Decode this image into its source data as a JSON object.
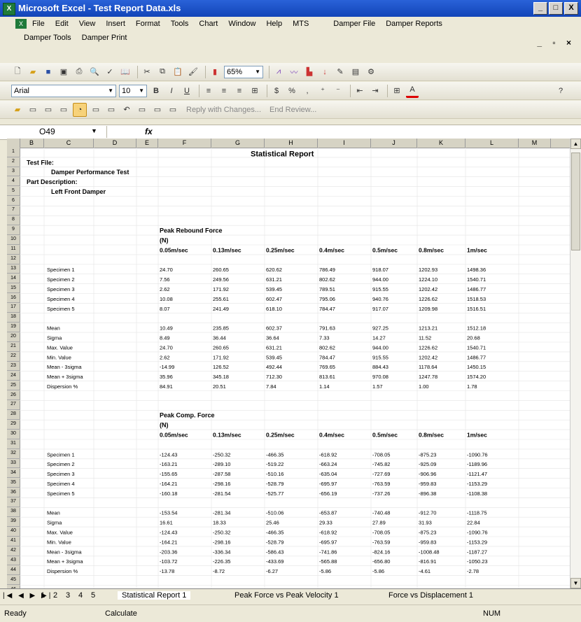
{
  "window": {
    "title": "Microsoft Excel - Test Report Data.xls",
    "minimize": "_",
    "maximize": "□",
    "close": "X"
  },
  "menu": {
    "row1": [
      "File",
      "Edit",
      "View",
      "Insert",
      "Format",
      "Tools",
      "Chart",
      "Window",
      "Help",
      "MTS",
      "Damper File",
      "Damper Reports"
    ],
    "row2": [
      "Damper Tools",
      "Damper Print"
    ],
    "doc_controls": "_ ▫ ×"
  },
  "toolbar": {
    "zoom": "65%",
    "font": "Arial",
    "size": "10",
    "reply": "Reply with Changes...",
    "end_review": "End Review..."
  },
  "formula": {
    "name_box": "O49",
    "fx": "fx"
  },
  "grid": {
    "columns": [
      "B",
      "C",
      "D",
      "E",
      "F",
      "G",
      "H",
      "I",
      "J",
      "K",
      "L",
      "M"
    ],
    "rows": [
      "1",
      "2",
      "3",
      "4",
      "5",
      "6",
      "7",
      "8",
      "9",
      "10",
      "11",
      "12",
      "13",
      "14",
      "15",
      "16",
      "17",
      "18",
      "19",
      "20",
      "21",
      "22",
      "23",
      "24",
      "25",
      "26",
      "27",
      "28",
      "29",
      "30",
      "31",
      "32",
      "33",
      "34",
      "35",
      "36",
      "37",
      "38",
      "39",
      "40",
      "41",
      "42",
      "43",
      "44",
      "45",
      "46"
    ]
  },
  "report": {
    "title": "Statistical Report",
    "test_file_label": "Test File:",
    "test_file": "Damper Performance Test",
    "part_label": "Part Description:",
    "part": "Left Front Damper",
    "speeds": [
      "0.05m/sec",
      "0.13m/sec",
      "0.25m/sec",
      "0.4m/sec",
      "0.5m/sec",
      "0.8m/sec",
      "1m/sec"
    ],
    "blocks": [
      {
        "title": "Peak Rebound Force",
        "unit": "(N)",
        "specimens": [
          {
            "label": "Specimen 1",
            "values": [
              "24.70",
              "260.65",
              "620.62",
              "786.49",
              "918.07",
              "1202.93",
              "1498.36"
            ]
          },
          {
            "label": "Specimen 2",
            "values": [
              "7.56",
              "249.56",
              "631.21",
              "802.62",
              "944.00",
              "1224.10",
              "1540.71"
            ]
          },
          {
            "label": "Specimen 3",
            "values": [
              "2.62",
              "171.92",
              "539.45",
              "789.51",
              "915.55",
              "1202.42",
              "1486.77"
            ]
          },
          {
            "label": "Specimen 4",
            "values": [
              "10.08",
              "255.61",
              "602.47",
              "795.06",
              "940.76",
              "1226.62",
              "1518.53"
            ]
          },
          {
            "label": "Specimen 5",
            "values": [
              "8.07",
              "241.49",
              "618.10",
              "784.47",
              "917.07",
              "1209.98",
              "1516.51"
            ]
          }
        ],
        "stats": [
          {
            "label": "Mean",
            "values": [
              "10.49",
              "235.85",
              "602.37",
              "791.63",
              "927.25",
              "1213.21",
              "1512.18"
            ]
          },
          {
            "label": "Sigma",
            "values": [
              "8.49",
              "36.44",
              "36.64",
              "7.33",
              "14.27",
              "11.52",
              "20.68"
            ]
          },
          {
            "label": "Max. Value",
            "values": [
              "24.70",
              "260.65",
              "631.21",
              "802.62",
              "944.00",
              "1226.62",
              "1540.71"
            ]
          },
          {
            "label": "Min. Value",
            "values": [
              "2.62",
              "171.92",
              "539.45",
              "784.47",
              "915.55",
              "1202.42",
              "1486.77"
            ]
          },
          {
            "label": "Mean - 3sigma",
            "values": [
              "-14.99",
              "126.52",
              "492.44",
              "769.65",
              "884.43",
              "1178.64",
              "1450.15"
            ]
          },
          {
            "label": "Mean + 3sigma",
            "values": [
              "35.96",
              "345.18",
              "712.30",
              "813.61",
              "970.08",
              "1247.78",
              "1574.20"
            ]
          },
          {
            "label": "Dispersion %",
            "values": [
              "84.91",
              "20.51",
              "7.84",
              "1.14",
              "1.57",
              "1.00",
              "1.78"
            ]
          }
        ]
      },
      {
        "title": "Peak Comp. Force",
        "unit": "(N)",
        "specimens": [
          {
            "label": "Specimen 1",
            "values": [
              "-124.43",
              "-250.32",
              "-466.35",
              "-618.92",
              "-708.05",
              "-875.23",
              "-1090.76"
            ]
          },
          {
            "label": "Specimen 2",
            "values": [
              "-163.21",
              "-289.10",
              "-519.22",
              "-663.24",
              "-745.82",
              "-925.09",
              "-1189.96"
            ]
          },
          {
            "label": "Specimen 3",
            "values": [
              "-155.65",
              "-287.58",
              "-510.16",
              "-635.04",
              "-727.69",
              "-906.96",
              "-1121.47"
            ]
          },
          {
            "label": "Specimen 4",
            "values": [
              "-164.21",
              "-298.16",
              "-528.79",
              "-695.97",
              "-763.59",
              "-959.83",
              "-1153.29"
            ]
          },
          {
            "label": "Specimen 5",
            "values": [
              "-160.18",
              "-281.54",
              "-525.77",
              "-656.19",
              "-737.26",
              "-896.38",
              "-1108.38"
            ]
          }
        ],
        "stats": [
          {
            "label": "Mean",
            "values": [
              "-153.54",
              "-281.34",
              "-510.06",
              "-653.87",
              "-740.48",
              "-912.70",
              "-1118.75"
            ]
          },
          {
            "label": "Sigma",
            "values": [
              "16.61",
              "18.33",
              "25.46",
              "29.33",
              "27.89",
              "31.93",
              "22.84"
            ]
          },
          {
            "label": "Max. Value",
            "values": [
              "-124.43",
              "-250.32",
              "-466.35",
              "-618.92",
              "-708.05",
              "-875.23",
              "-1090.76"
            ]
          },
          {
            "label": "Min. Value",
            "values": [
              "-164.21",
              "-298.16",
              "-528.79",
              "-695.97",
              "-763.59",
              "-959.83",
              "-1153.29"
            ]
          },
          {
            "label": "Mean - 3sigma",
            "values": [
              "-203.36",
              "-336.34",
              "-586.43",
              "-741.86",
              "-824.16",
              "-1008.48",
              "-1187.27"
            ]
          },
          {
            "label": "Mean + 3sigma",
            "values": [
              "-103.72",
              "-226.35",
              "-433.69",
              "-565.88",
              "-656.80",
              "-816.91",
              "-1050.23"
            ]
          },
          {
            "label": "Dispersion %",
            "values": [
              "-13.78",
              "-8.72",
              "-6.27",
              "-5.86",
              "-5.86",
              "-4.61",
              "-2.78"
            ]
          }
        ]
      }
    ]
  },
  "tabs": [
    "1",
    "2",
    "3",
    "4",
    "5",
    "Statistical Report 1",
    "Peak Force vs Peak Velocity 1",
    "Force vs Displacement 1"
  ],
  "status": {
    "left": "Ready",
    "mid": "Calculate",
    "right": "NUM"
  }
}
